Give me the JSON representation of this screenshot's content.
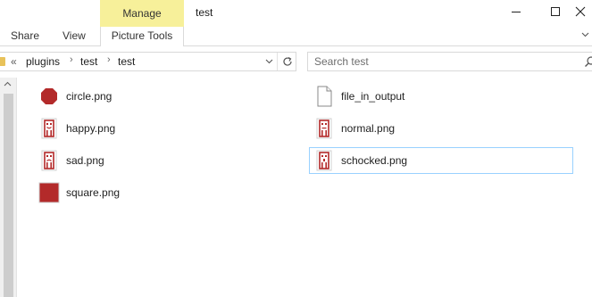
{
  "titlebar": {
    "manage_tab": "Manage",
    "title": "test"
  },
  "ribbon": {
    "tabs": [
      "Share",
      "View",
      "Picture Tools"
    ]
  },
  "address": {
    "overflow": "«",
    "crumbs": [
      "plugins",
      "test",
      "test"
    ]
  },
  "search": {
    "placeholder": "Search test"
  },
  "files": [
    {
      "name": "circle.png",
      "icon": "red-circle-icon"
    },
    {
      "name": "happy.png",
      "icon": "happy-face-icon"
    },
    {
      "name": "sad.png",
      "icon": "sad-face-icon"
    },
    {
      "name": "square.png",
      "icon": "red-square-icon"
    },
    {
      "name": "file_in_output",
      "icon": "blank-file-icon"
    },
    {
      "name": "normal.png",
      "icon": "normal-face-icon"
    },
    {
      "name": "schocked.png",
      "icon": "shocked-face-icon",
      "selected": true
    }
  ],
  "colors": {
    "manage_tab": "#f7f09a",
    "icon_red": "#b32a2a",
    "selection_border": "#99d1ff"
  }
}
